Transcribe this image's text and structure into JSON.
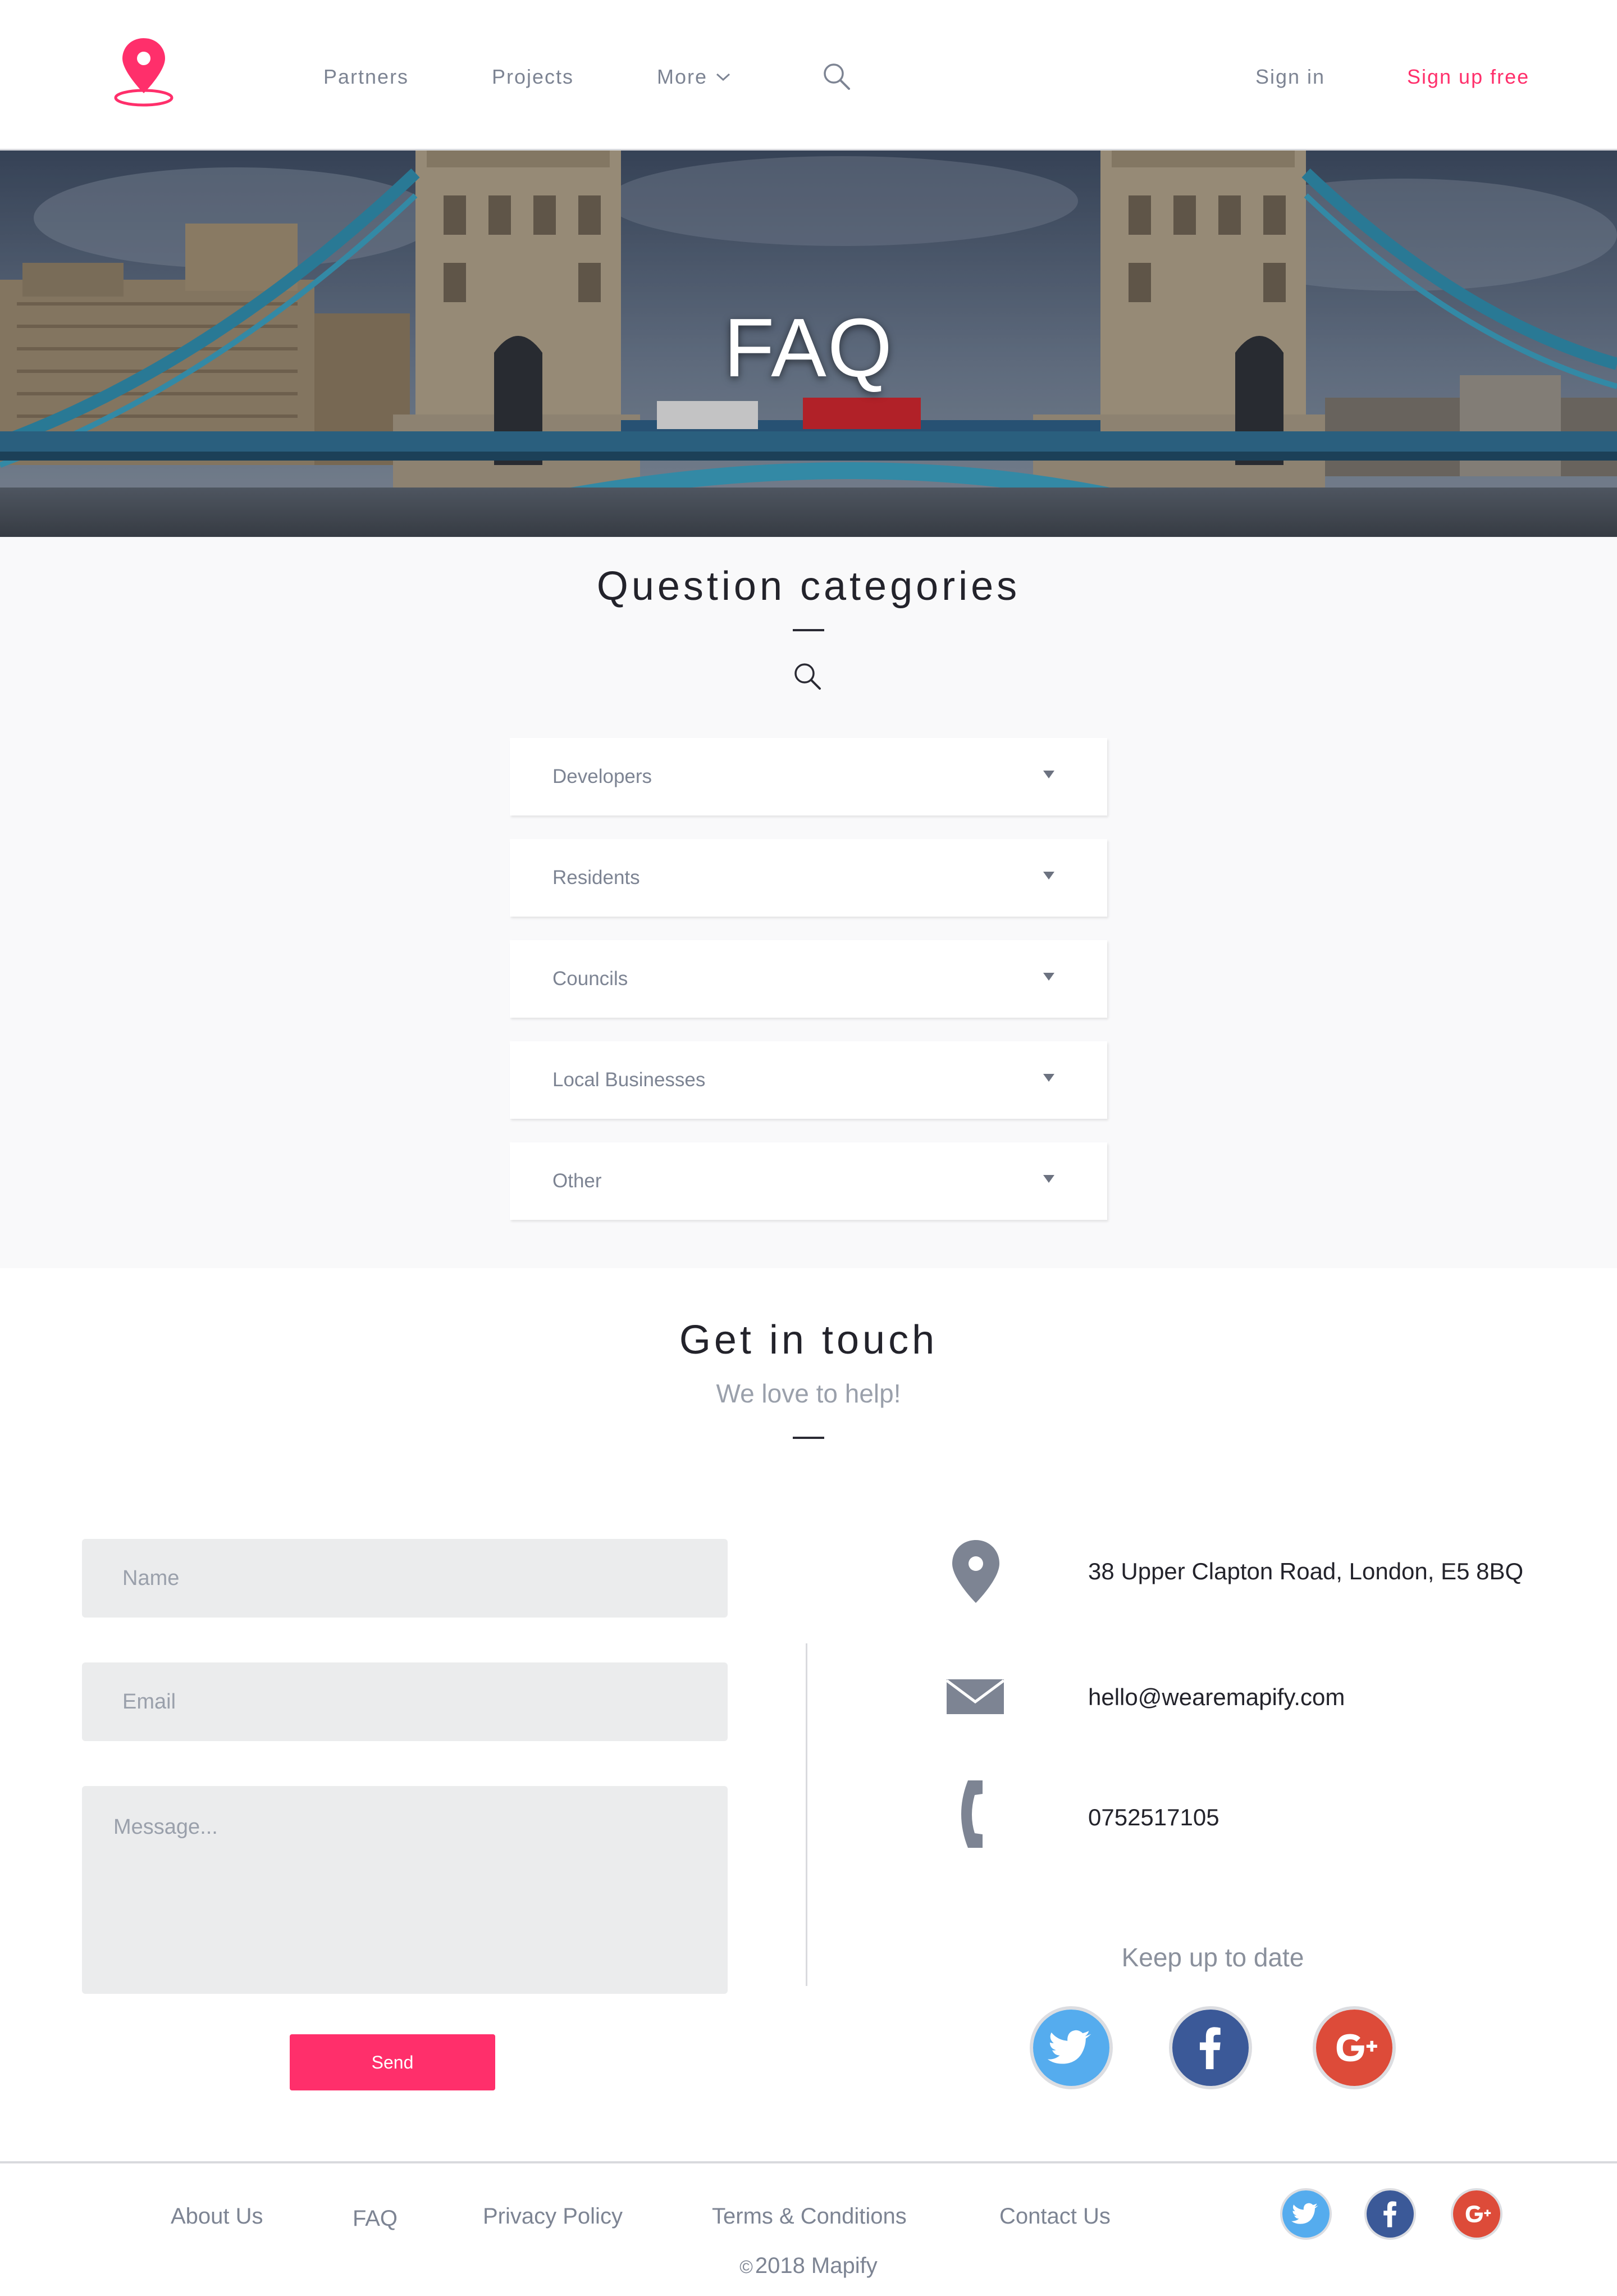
{
  "nav": {
    "links": [
      {
        "label": "Partners"
      },
      {
        "label": "Projects"
      },
      {
        "label": "More"
      }
    ],
    "sign_in": "Sign in",
    "sign_up": "Sign up free",
    "colors": {
      "accent": "#ff2f6b",
      "link": "#7d8493"
    },
    "icons": {
      "logo": "map-pin-logo",
      "search": "search-icon",
      "dropdown": "chevron-down-icon"
    }
  },
  "hero": {
    "title": "FAQ",
    "image": "tower-bridge-photo"
  },
  "categories": {
    "title": "Question categories",
    "search_icon": "search-icon",
    "items": [
      {
        "label": "Developers"
      },
      {
        "label": "Residents"
      },
      {
        "label": "Councils"
      },
      {
        "label": "Local Businesses"
      },
      {
        "label": "Other"
      }
    ]
  },
  "contact": {
    "title": "Get in touch",
    "subtitle": "We love to help!",
    "form": {
      "name_placeholder": "Name",
      "email_placeholder": "Email",
      "message_placeholder": "Message...",
      "send_label": "Send"
    },
    "info": {
      "address": "38 Upper Clapton Road, London, E5 8BQ",
      "email": "hello@wearemapify.com",
      "phone": "0752517105"
    },
    "keep_up": "Keep up to date",
    "social": [
      "twitter-icon",
      "facebook-icon",
      "google-plus-icon"
    ],
    "social_colors": {
      "twitter": "#55acee",
      "facebook": "#3b5998",
      "google_plus": "#dd4b39"
    }
  },
  "footer": {
    "links": [
      {
        "label": "About Us"
      },
      {
        "label": "FAQ"
      },
      {
        "label": "Privacy Policy"
      },
      {
        "label": "Terms & Conditions"
      },
      {
        "label": "Contact Us"
      }
    ],
    "copyright_symbol": "©",
    "copyright": "2018 Mapify"
  }
}
